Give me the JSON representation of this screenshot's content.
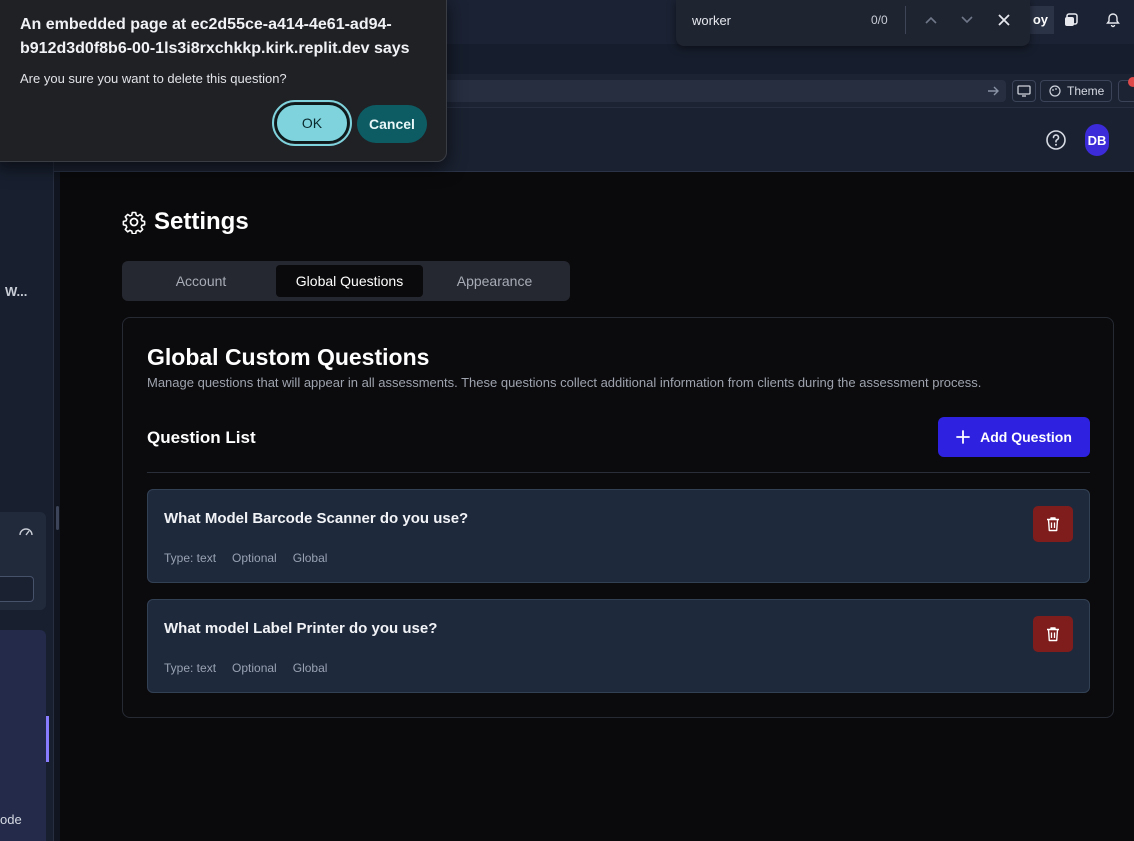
{
  "dialog": {
    "title": "An embedded page at ec2d55ce-a414-4e61-ad94-b912d3d0f8b6-00-1ls3i8rxchkkp.kirk.replit.dev says",
    "message": "Are you sure you want to delete this question?",
    "ok_label": "OK",
    "cancel_label": "Cancel"
  },
  "find_bar": {
    "query": "worker",
    "count": "0/0"
  },
  "top_bar": {
    "partial_label": "oy"
  },
  "url_bar": {
    "theme_label": "Theme"
  },
  "app_header": {
    "avatar_initials": "DB"
  },
  "sidebar": {
    "truncated_label": "W...",
    "bottom_label": "ode"
  },
  "settings": {
    "title": "Settings",
    "tabs": [
      {
        "label": "Account",
        "active": false
      },
      {
        "label": "Global Questions",
        "active": true
      },
      {
        "label": "Appearance",
        "active": false
      }
    ]
  },
  "card": {
    "title": "Global Custom Questions",
    "description": "Manage questions that will appear in all assessments. These questions collect additional information from clients during the assessment process.",
    "list_header": "Question List",
    "add_button_label": "Add Question",
    "questions": [
      {
        "text": "What Model Barcode Scanner do you use?",
        "type": "Type: text",
        "required": "Optional",
        "scope": "Global"
      },
      {
        "text": "What model Label Printer do you use?",
        "type": "Type: text",
        "required": "Optional",
        "scope": "Global"
      }
    ]
  },
  "colors": {
    "accent": "#2e22e0",
    "delete": "#7f1d1d",
    "ok": "#7fd3dd",
    "cancel": "#0d5c63"
  }
}
